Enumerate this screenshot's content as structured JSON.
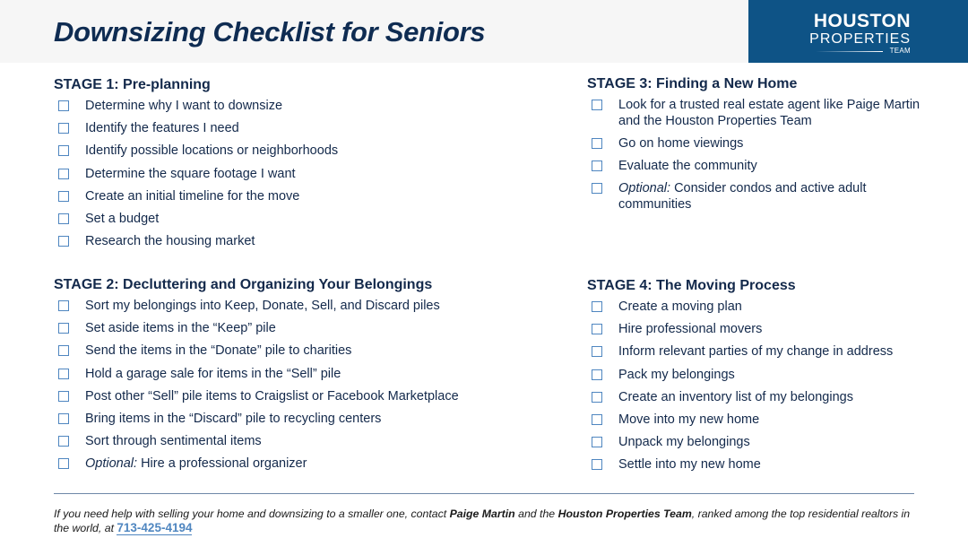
{
  "header": {
    "title": "Downsizing Checklist for Seniors",
    "logo": {
      "line1": "HOUSTON",
      "line2": "PROPERTIES",
      "line3": "TEAM"
    }
  },
  "colors": {
    "navy": "#0f2c52",
    "brand_blue": "#0e5386",
    "checkbox_blue": "#4f86c0",
    "header_bg": "#f6f6f6"
  },
  "stages": [
    {
      "title": "STAGE 1: Pre-planning",
      "items": [
        {
          "prefix": "",
          "text": "Determine why I want to downsize",
          "checked": false
        },
        {
          "prefix": "",
          "text": "Identify the features I need",
          "checked": false
        },
        {
          "prefix": "",
          "text": "Identify possible locations or neighborhoods",
          "checked": false
        },
        {
          "prefix": "",
          "text": "Determine the square footage I want",
          "checked": false
        },
        {
          "prefix": "",
          "text": "Create an initial timeline for the move",
          "checked": false
        },
        {
          "prefix": "",
          "text": "Set a budget",
          "checked": false
        },
        {
          "prefix": "",
          "text": "Research the housing market",
          "checked": false
        }
      ]
    },
    {
      "title": "STAGE 2: Decluttering and Organizing Your Belongings",
      "items": [
        {
          "prefix": "",
          "text": "Sort my belongings into Keep, Donate, Sell, and Discard piles",
          "checked": false
        },
        {
          "prefix": "",
          "text": "Set aside items in the “Keep” pile",
          "checked": false
        },
        {
          "prefix": "",
          "text": "Send the items in the “Donate” pile to charities",
          "checked": false
        },
        {
          "prefix": "",
          "text": "Hold a garage sale for items in the “Sell” pile",
          "checked": false
        },
        {
          "prefix": "",
          "text": "Post other “Sell” pile items to Craigslist or Facebook Marketplace",
          "checked": false
        },
        {
          "prefix": "",
          "text": "Bring items in the “Discard” pile to recycling centers",
          "checked": false
        },
        {
          "prefix": "",
          "text": "Sort through sentimental items",
          "checked": false
        },
        {
          "prefix": "Optional:",
          "text": " Hire a professional organizer",
          "checked": false
        }
      ]
    },
    {
      "title": "STAGE 3: Finding a New Home",
      "items": [
        {
          "prefix": "",
          "text": "Look for a trusted real estate agent like Paige Martin and the Houston Properties Team",
          "checked": false
        },
        {
          "prefix": "",
          "text": "Go on home viewings",
          "checked": false
        },
        {
          "prefix": "",
          "text": "Evaluate the community",
          "checked": false
        },
        {
          "prefix": "Optional:",
          "text": " Consider condos and active adult communities",
          "checked": false
        }
      ]
    },
    {
      "title": "STAGE 4: The Moving Process",
      "items": [
        {
          "prefix": "",
          "text": "Create a moving plan",
          "checked": false
        },
        {
          "prefix": "",
          "text": "Hire professional movers",
          "checked": false
        },
        {
          "prefix": "",
          "text": "Inform relevant parties of my change in address",
          "checked": false
        },
        {
          "prefix": "",
          "text": "Pack my belongings",
          "checked": false
        },
        {
          "prefix": "",
          "text": "Create an inventory list of my belongings",
          "checked": false
        },
        {
          "prefix": "",
          "text": "Move into my new home",
          "checked": false
        },
        {
          "prefix": "",
          "text": "Unpack my belongings",
          "checked": false
        },
        {
          "prefix": "",
          "text": "Settle into my new home",
          "checked": false
        }
      ]
    }
  ],
  "footer": {
    "text1": "If you need help with selling your home and downsizing to a smaller one, contact ",
    "name": "Paige Martin",
    "text2": " and the ",
    "team": "Houston Properties Team",
    "text3": ", ranked among the top residential realtors in the world, at ",
    "phone": "713-425-4194"
  }
}
